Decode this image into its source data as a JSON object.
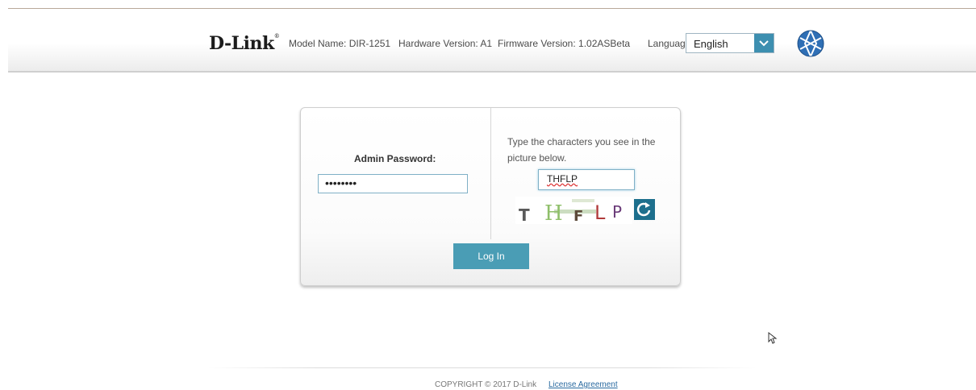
{
  "header": {
    "brand": "D-Link",
    "brand_mark": "®",
    "model_name": "Model Name: DIR-1251",
    "hardware_version": "Hardware Version: A1",
    "firmware_version": "Firmware Version: 1.02ASBeta",
    "language_label": "Language:",
    "language_value": "English",
    "globe_icon": "globe-icon"
  },
  "login": {
    "password_label": "Admin Password:",
    "password_value": "••••••••",
    "captcha_hint": "Type the characters you see in the picture below.",
    "captcha_value": "THFLP",
    "captcha_image_chars": [
      "T",
      "H",
      "F",
      "L",
      "P"
    ],
    "refresh_icon": "refresh-icon",
    "login_button": "Log In"
  },
  "footer": {
    "copyright": "COPYRIGHT © 2017 D-Link",
    "license_link": "License Agreement"
  },
  "colors": {
    "accent": "#4a9db5",
    "refresh_bg": "#1d6f8d",
    "language_caret_bg": "#3d8fb0"
  }
}
